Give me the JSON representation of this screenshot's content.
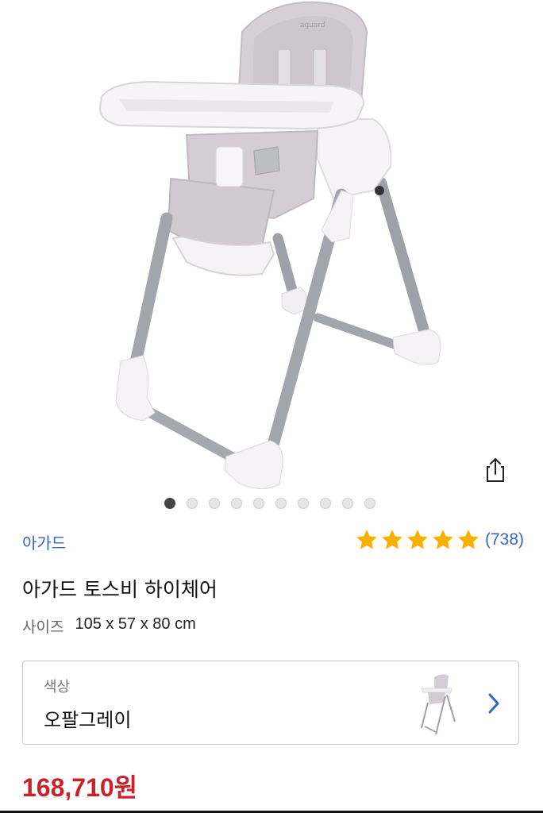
{
  "product_image": {
    "logo_text": "aguard",
    "colors": {
      "seat": "#d6cdd4",
      "frame": "#f3f1f3",
      "legs": "#a7a9b0",
      "tray": "#f6f4f6"
    }
  },
  "carousel": {
    "total": 10,
    "active_index": 0
  },
  "brand": "아가드",
  "rating": {
    "stars": 5,
    "count": "(738)",
    "star_color": "#f5b000"
  },
  "product": {
    "title": "아가드 토스비 하이체어",
    "size_label": "사이즈",
    "size_value": "105 x 57 x 80 cm"
  },
  "option": {
    "label": "색상",
    "value": "오팔그레이"
  },
  "price": "168,710원",
  "colors": {
    "link_blue": "#3466c2",
    "price_red": "#c9222a"
  }
}
